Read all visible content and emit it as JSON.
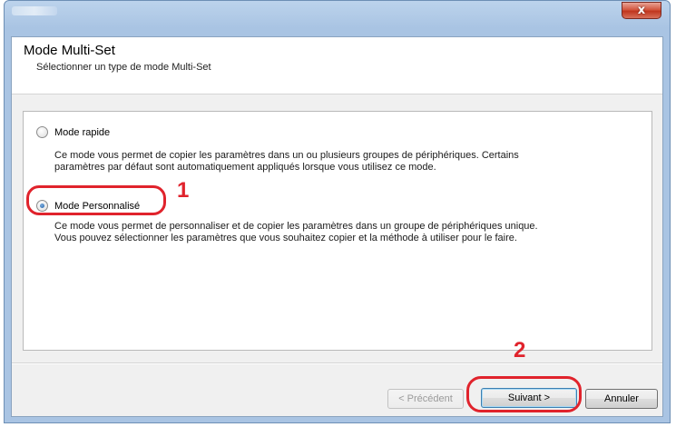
{
  "window": {
    "close_label": "x"
  },
  "header": {
    "title": "Mode Multi-Set",
    "subtitle": "Sélectionner un type de mode Multi-Set"
  },
  "options": [
    {
      "label": "Mode rapide",
      "selected": false,
      "description_lines": [
        "Ce mode vous permet de copier les paramètres dans un ou plusieurs groupes de périphériques. Certains",
        "paramètres par défaut sont automatiquement appliqués lorsque vous utilisez ce mode."
      ]
    },
    {
      "label": "Mode Personnalisé",
      "selected": true,
      "description_lines": [
        "Ce mode vous permet de personnaliser et de copier les paramètres dans un groupe de périphériques unique.",
        "Vous pouvez sélectionner les paramètres que vous souhaitez copier et la méthode à utiliser pour le faire."
      ]
    }
  ],
  "footer": {
    "back_label": "< Précédent",
    "back_enabled": false,
    "next_label": "Suivant >",
    "cancel_label": "Annuler"
  },
  "annotations": {
    "callout_1": "1",
    "callout_2": "2",
    "highlight_color": "#e0232c"
  }
}
